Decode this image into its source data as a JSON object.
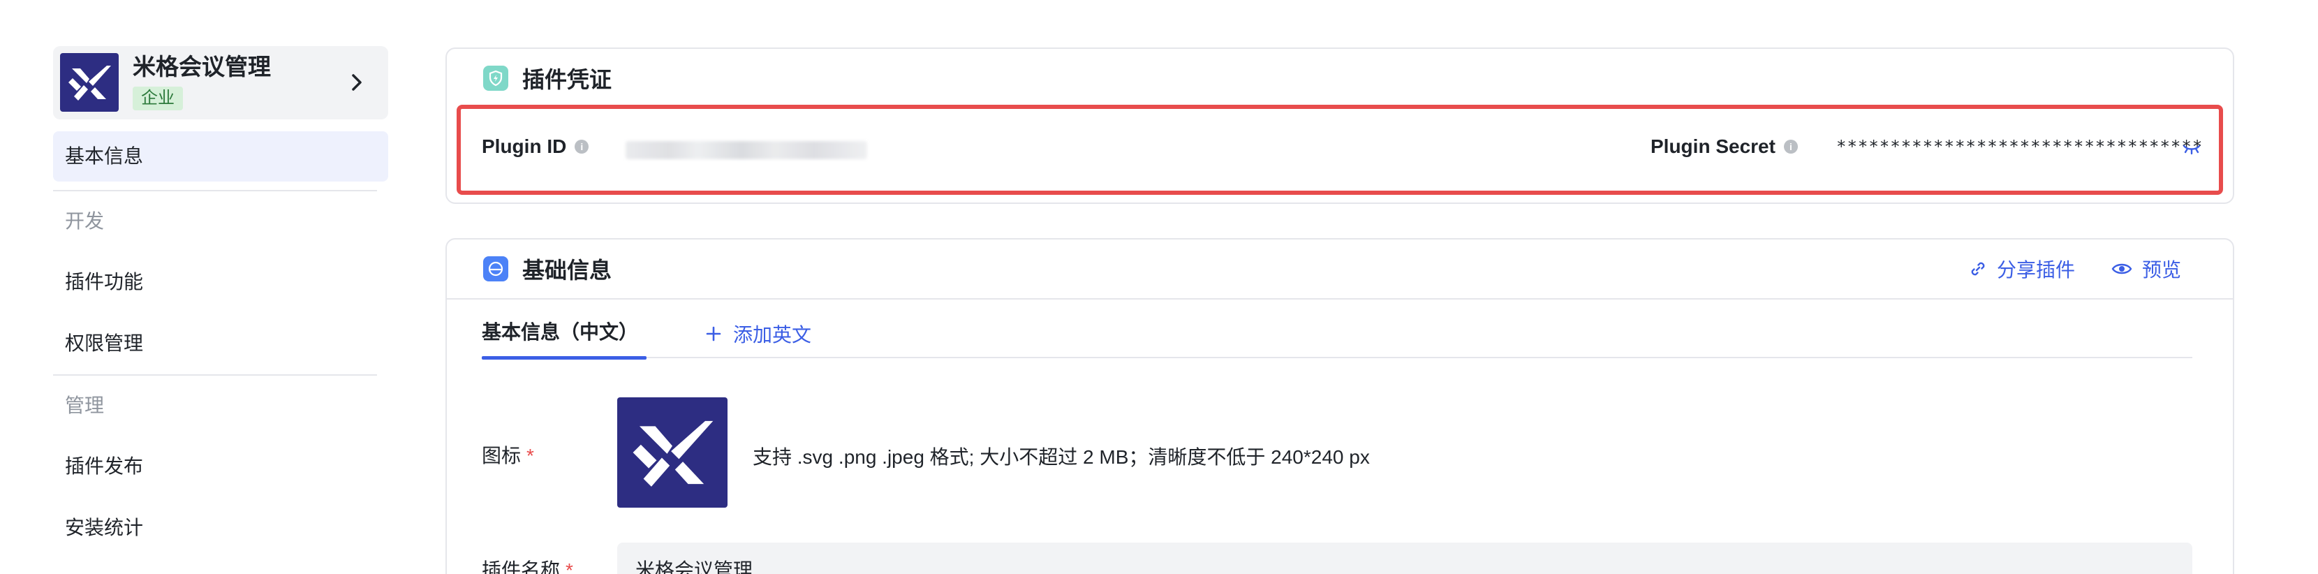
{
  "sidebar": {
    "app": {
      "name": "米格会议管理",
      "badge": "企业",
      "logo_icon": "logo-icon"
    },
    "active_item": "基本信息",
    "sections": [
      {
        "title": "开发",
        "items": [
          "插件功能",
          "权限管理"
        ]
      },
      {
        "title": "管理",
        "items": [
          "插件发布",
          "安装统计"
        ]
      }
    ]
  },
  "credentials": {
    "title": "插件凭证",
    "plugin_id_label": "Plugin ID",
    "plugin_secret_label": "Plugin Secret",
    "plugin_secret_value": "**********************************"
  },
  "basic_info": {
    "title": "基础信息",
    "actions": {
      "share": "分享插件",
      "preview": "预览"
    },
    "tabs": {
      "active": "基本信息（中文）",
      "add": "添加英文"
    },
    "icon_label": "图标",
    "required_mark": "*",
    "icon_hint": "支持 .svg .png .jpeg 格式; 大小不超过 2 MB；清晰度不低于 240*240 px",
    "name_label": "插件名称",
    "name_value": "米格会议管理"
  },
  "colors": {
    "accent": "#3b5ee5",
    "highlight_border": "#e84c4c",
    "logo_bg": "#2d2d82",
    "badge_bg": "#d6f0d9",
    "badge_text": "#2d7a3c",
    "credential_icon_bg": "#7fd8c8",
    "basic_info_icon_bg": "#4c82f7"
  }
}
